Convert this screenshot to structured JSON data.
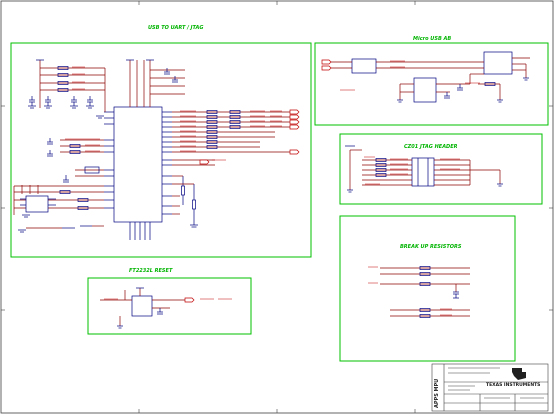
{
  "sheet_colors": {
    "block_border": "#00c000",
    "block_title": "#00b400",
    "wire": "#8b0000",
    "net_label": "#c00000",
    "part": "#000080",
    "frame": "#404040"
  },
  "blocks": {
    "usb_uart_jtag": {
      "title": "USB TO UART / JTAG"
    },
    "micro_usb": {
      "title": "Micro USB AB"
    },
    "jtag_header": {
      "title": "CZ01 JTAG HEADER"
    },
    "pullup": {
      "title": "BREAK UP RESISTORS"
    },
    "reset": {
      "title": "FT2232L RESET"
    }
  },
  "title_block": {
    "vertical_tag": "APPS MPU",
    "company": "TEXAS INSTRUMENTS"
  }
}
